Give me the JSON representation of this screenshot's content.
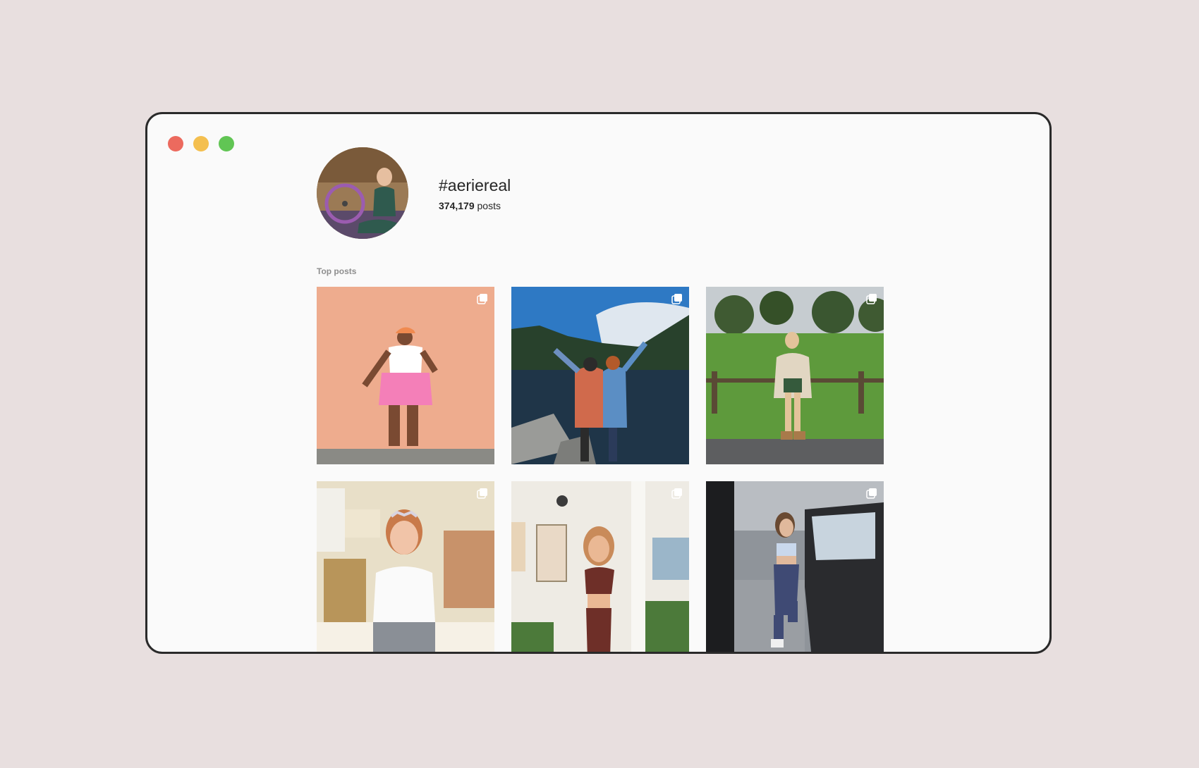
{
  "window_controls": {
    "close_color": "#ec6a5e",
    "minimize_color": "#f4bf4f",
    "maximize_color": "#61c554"
  },
  "hashtag": {
    "title": "#aeriereal",
    "post_count": "374,179",
    "post_label": "posts"
  },
  "top_posts": {
    "label": "Top posts",
    "items": [
      {
        "icon": "multiple-photos-icon"
      },
      {
        "icon": "multiple-photos-icon"
      },
      {
        "icon": "multiple-photos-icon"
      },
      {
        "icon": "multiple-photos-icon"
      },
      {
        "icon": "multiple-photos-icon"
      },
      {
        "icon": "multiple-photos-icon"
      }
    ]
  }
}
